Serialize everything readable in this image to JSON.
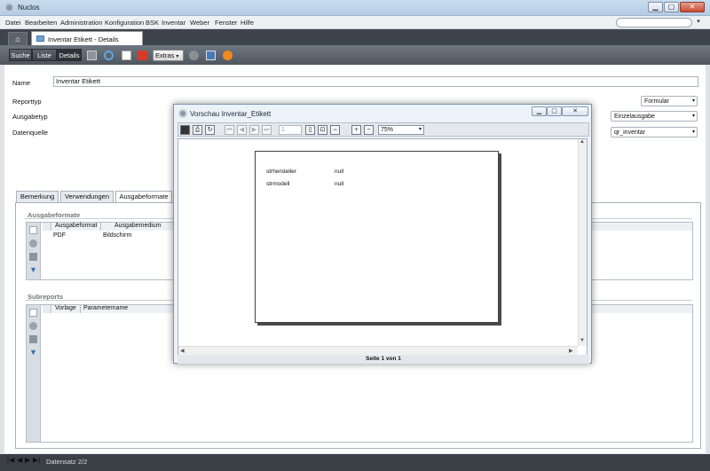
{
  "app": {
    "title": "Nuclos"
  },
  "window_controls": {
    "minimize": "▁",
    "maximize": "▢",
    "close": "✕"
  },
  "menu": [
    "Datei",
    "Bearbeiten",
    "Administration",
    "Konfiguration",
    "BSK",
    "Inventar",
    "Weber",
    "Fenster",
    "Hilfe"
  ],
  "tab": {
    "label": "Inventar Etikett - Details"
  },
  "toolbar": {
    "crumbs": [
      "Suche",
      "Liste",
      "Details"
    ],
    "extras": "Extras"
  },
  "form": {
    "name_label": "Name",
    "name_value": "Inventar Etikett",
    "reporttyp_label": "Reporttyp",
    "reporttyp_value": "Formular",
    "ausgabetyp_label": "Ausgabetyp",
    "ausgabetyp_value": "Einzelausgabe",
    "datenquelle_label": "Datenquelle",
    "datenquelle_value": "qr_inventar"
  },
  "tabs": [
    "Bemerkung",
    "Verwendungen",
    "Ausgabeformate"
  ],
  "ausgabeformate": {
    "title": "Ausgabeformate",
    "columns": [
      "Ausgabeformat",
      "Ausgabemedium"
    ],
    "rows": [
      [
        "PDF",
        "Bildschirm"
      ]
    ]
  },
  "subreports": {
    "title": "Subreports",
    "columns": [
      "Vorlage",
      "Parametername"
    ]
  },
  "status": {
    "record": "Datensatz 2/2"
  },
  "preview": {
    "title": "Vorschau Inventar_Etikett",
    "page_input": "1",
    "zoom": "75%",
    "fields": [
      {
        "label": "strhersteller",
        "value": "null"
      },
      {
        "label": "strmodell",
        "value": "null"
      }
    ],
    "footer": "Seite 1 von 1"
  }
}
